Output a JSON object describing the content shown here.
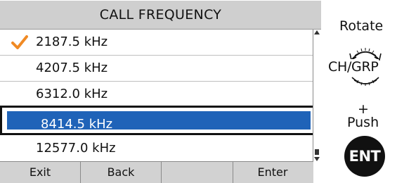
{
  "screen": {
    "title": "CALL FREQUENCY",
    "items": [
      {
        "label": "2187.5 kHz",
        "checked": true
      },
      {
        "label": "4207.5 kHz",
        "checked": false
      },
      {
        "label": "6312.0 kHz",
        "checked": false
      },
      {
        "label": "8414.5 kHz",
        "checked": false,
        "selected": true
      },
      {
        "label": "12577.0 kHz",
        "checked": false
      }
    ],
    "softkeys": [
      "Exit",
      "Back",
      "",
      "Enter"
    ],
    "colors": {
      "highlight": "#1f63b8",
      "check": "#f08a24",
      "title_bar": "#cfcfcf"
    }
  },
  "controls": {
    "rotate_label": "Rotate",
    "knob_label": "CH/GRP",
    "plus_label": "+",
    "push_label": "Push",
    "ent_label": "ENT",
    "knob_icon": "rotary-knob-icon"
  }
}
